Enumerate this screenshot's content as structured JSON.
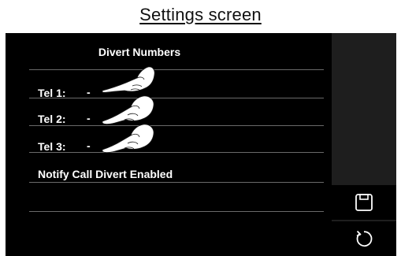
{
  "caption": "Settings screen",
  "panel": {
    "title": "Divert Numbers",
    "rows": [
      {
        "label": "Tel 1:",
        "value": "-"
      },
      {
        "label": "Tel 2:",
        "value": "-"
      },
      {
        "label": "Tel 3:",
        "value": "-"
      }
    ],
    "notify_label": "Notify Call Divert Enabled"
  },
  "side_buttons": [
    {
      "name": "save",
      "icon": "save-icon"
    },
    {
      "name": "back",
      "icon": "undo-icon"
    }
  ],
  "colors": {
    "screen_bg": "#000000",
    "side_panel_bg": "#1e1e1e",
    "text": "#ffffff",
    "divider": "#6a6a6a"
  }
}
